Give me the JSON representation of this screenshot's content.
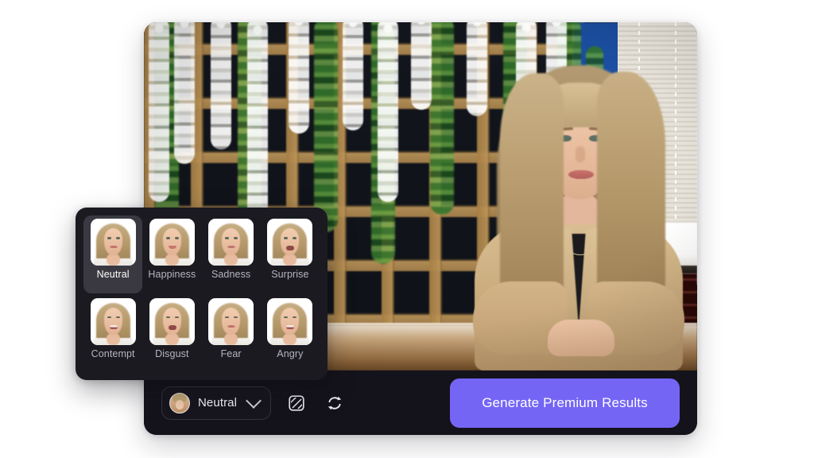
{
  "colors": {
    "page_background": "#ffffff",
    "app_panel": "#14131b",
    "emotion_panel": "#1b1a21",
    "selected_chip": "#3a3941",
    "accent_button": "#7465f5",
    "label_muted": "#b6b5be",
    "label_active": "#ffffff"
  },
  "app": {
    "video": {
      "subject_alt": "Woman with long blonde hair wearing a beige blazer seated at a wooden table",
      "background_alt": "Wooden lattice wall with white wisteria flowers and green ivy, window blinds and brick wall on the right"
    },
    "toolbar": {
      "emotion_select": {
        "value": "Neutral",
        "chevron_icon": "chevron-down-icon",
        "avatar_icon": "avatar-thumbnail"
      },
      "style_button_icon": "diagonal-stripes-square-icon",
      "refresh_button_icon": "refresh-sync-icon",
      "generate_label": "Generate Premium Results"
    }
  },
  "emotion_panel": {
    "items": [
      {
        "label": "Neutral",
        "selected": true,
        "mouth": "neutral"
      },
      {
        "label": "Happiness",
        "selected": false,
        "mouth": "smile"
      },
      {
        "label": "Sadness",
        "selected": false,
        "mouth": "neutral"
      },
      {
        "label": "Surprise",
        "selected": false,
        "mouth": "open"
      },
      {
        "label": "Contempt",
        "selected": false,
        "mouth": "teeth"
      },
      {
        "label": "Disgust",
        "selected": false,
        "mouth": "open"
      },
      {
        "label": "Fear",
        "selected": false,
        "mouth": "neutral"
      },
      {
        "label": "Angry",
        "selected": false,
        "mouth": "teeth"
      }
    ]
  }
}
